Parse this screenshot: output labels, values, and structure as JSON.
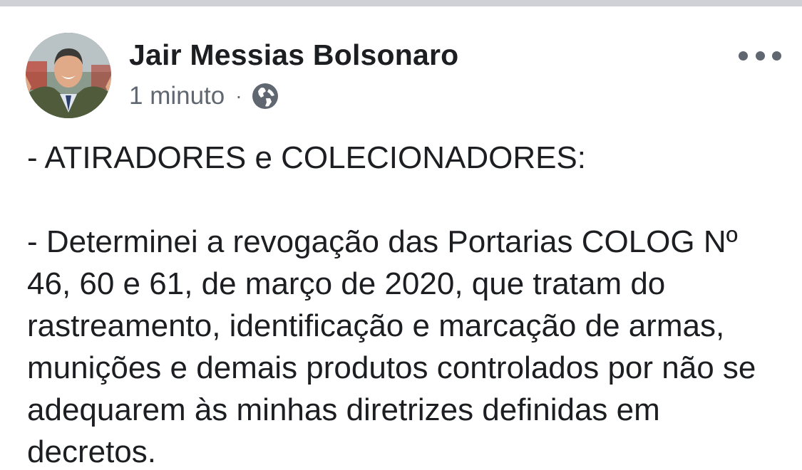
{
  "post": {
    "author": {
      "name": "Jair Messias Bolsonaro",
      "avatar_icon": "profile-photo"
    },
    "meta": {
      "time": "1 minuto",
      "separator": "·",
      "privacy_icon": "globe-icon"
    },
    "more_icon": "more-options-icon",
    "body": {
      "heading": "- ATIRADORES e COLECIONADORES:",
      "paragraph": "- Determinei a revogação das Portarias COLOG Nº 46, 60 e 61, de março de 2020, que tratam do rastreamento, identificação e marcação de armas, munições e demais produtos controlados por não se adequarem às minhas diretrizes definidas em decretos."
    }
  },
  "colors": {
    "background": "#ffffff",
    "divider": "#cfd1d6",
    "text_primary": "#1c1e21",
    "text_secondary": "#606770"
  }
}
